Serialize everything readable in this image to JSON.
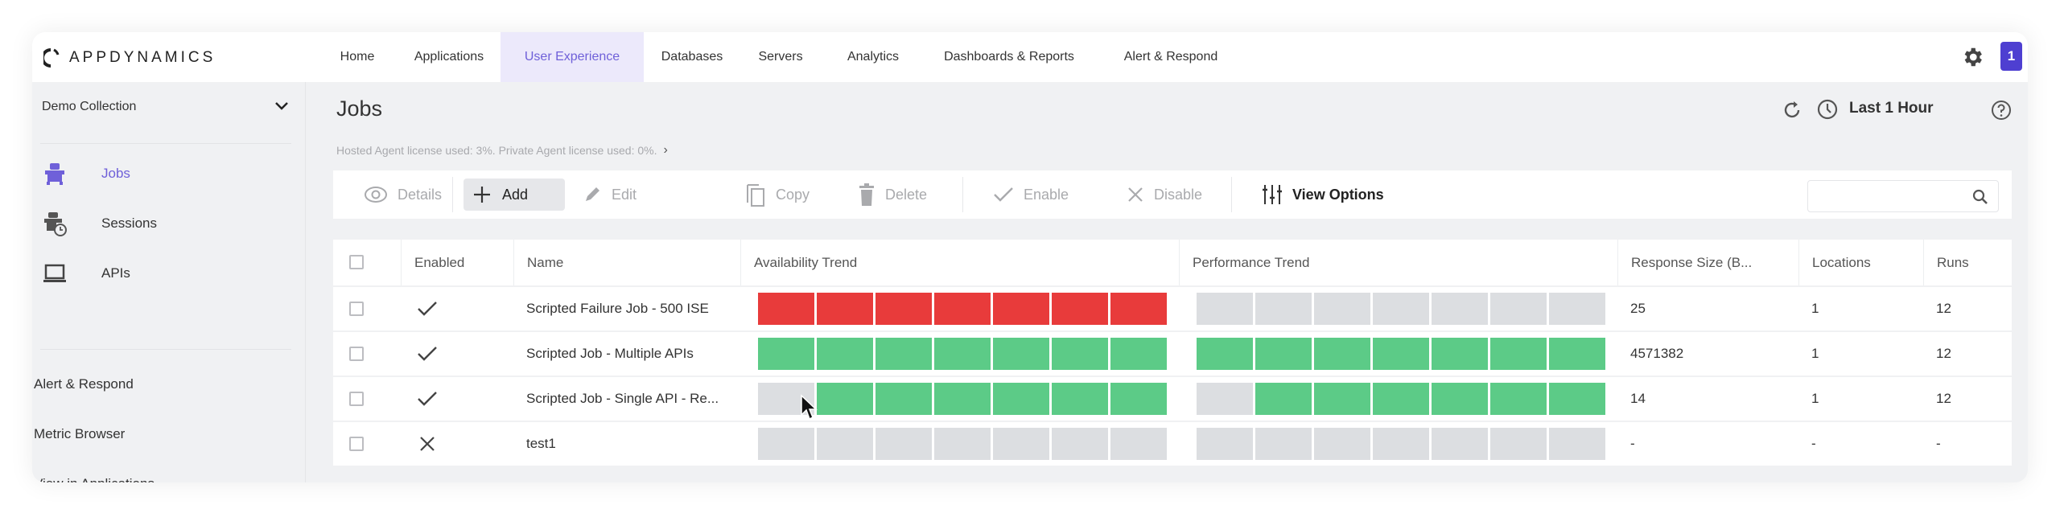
{
  "app": {
    "brand": "APPDYNAMICS",
    "notification_count": "1"
  },
  "nav": {
    "tabs": [
      {
        "label": "Home",
        "active": false
      },
      {
        "label": "Applications",
        "active": false
      },
      {
        "label": "User Experience",
        "active": true
      },
      {
        "label": "Databases",
        "active": false
      },
      {
        "label": "Servers",
        "active": false
      },
      {
        "label": "Analytics",
        "active": false
      },
      {
        "label": "Dashboards & Reports",
        "active": false
      },
      {
        "label": "Alert & Respond",
        "active": false
      }
    ]
  },
  "sidebar": {
    "collection": "Demo Collection",
    "items": [
      {
        "label": "Jobs",
        "icon": "robot-icon",
        "active": true
      },
      {
        "label": "Sessions",
        "icon": "robot-clock-icon",
        "active": false
      },
      {
        "label": "APIs",
        "icon": "laptop-icon",
        "active": false
      }
    ],
    "links": [
      {
        "label": "Alert & Respond"
      },
      {
        "label": "Metric Browser"
      },
      {
        "label": "View in Applications"
      }
    ]
  },
  "header": {
    "title": "Jobs",
    "time_range": "Last 1 Hour",
    "license_text": "Hosted Agent license used: 3%. Private Agent license used: 0%."
  },
  "toolbar": {
    "details": "Details",
    "add": "Add",
    "edit": "Edit",
    "copy": "Copy",
    "delete": "Delete",
    "enable": "Enable",
    "disable": "Disable",
    "view_options": "View Options",
    "search_value": "",
    "search_placeholder": ""
  },
  "colors": {
    "accent": "#6f60d9",
    "badge": "#4e3fd1",
    "fail": "#e83b3b",
    "ok": "#5ccb87",
    "no_data": "#dcdee1"
  },
  "table": {
    "columns": [
      "",
      "Enabled",
      "Name",
      "Availability Trend",
      "Performance Trend",
      "Response Size (B...",
      "Locations",
      "Runs"
    ],
    "rows": [
      {
        "enabled": true,
        "name": "Scripted Failure Job - 500 ISE",
        "availability": [
          "fail",
          "fail",
          "fail",
          "fail",
          "fail",
          "fail",
          "fail"
        ],
        "performance": [
          "none",
          "none",
          "none",
          "none",
          "none",
          "none",
          "none"
        ],
        "response_size": "25",
        "locations": "1",
        "runs": "12"
      },
      {
        "enabled": true,
        "name": "Scripted Job - Multiple APIs",
        "availability": [
          "ok",
          "ok",
          "ok",
          "ok",
          "ok",
          "ok",
          "ok"
        ],
        "performance": [
          "ok",
          "ok",
          "ok",
          "ok",
          "ok",
          "ok",
          "ok"
        ],
        "response_size": "4571382",
        "locations": "1",
        "runs": "12"
      },
      {
        "enabled": true,
        "name": "Scripted Job - Single API - Re...",
        "availability": [
          "none",
          "ok",
          "ok",
          "ok",
          "ok",
          "ok",
          "ok"
        ],
        "performance": [
          "none",
          "ok",
          "ok",
          "ok",
          "ok",
          "ok",
          "ok"
        ],
        "response_size": "14",
        "locations": "1",
        "runs": "12"
      },
      {
        "enabled": false,
        "name": "test1",
        "availability": [
          "none",
          "none",
          "none",
          "none",
          "none",
          "none",
          "none"
        ],
        "performance": [
          "none",
          "none",
          "none",
          "none",
          "none",
          "none",
          "none"
        ],
        "response_size": "-",
        "locations": "-",
        "runs": "-"
      }
    ]
  }
}
